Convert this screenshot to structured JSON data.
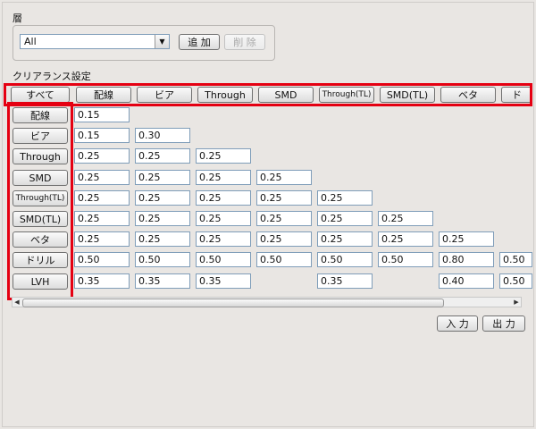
{
  "layer": {
    "label": "層",
    "selected_value": "All",
    "add_button": "追 加",
    "delete_button": "削 除"
  },
  "clearance": {
    "label": "クリアランス設定",
    "all_button": "すべて",
    "columns": [
      "配線",
      "ビア",
      "Through",
      "SMD",
      "Through(TL)",
      "SMD(TL)",
      "ベタ",
      "ド"
    ],
    "rows": [
      {
        "name": "配線",
        "values": [
          "0.15"
        ]
      },
      {
        "name": "ビア",
        "values": [
          "0.15",
          "0.30"
        ]
      },
      {
        "name": "Through",
        "values": [
          "0.25",
          "0.25",
          "0.25"
        ]
      },
      {
        "name": "SMD",
        "values": [
          "0.25",
          "0.25",
          "0.25",
          "0.25"
        ]
      },
      {
        "name": "Through(TL)",
        "values": [
          "0.25",
          "0.25",
          "0.25",
          "0.25",
          "0.25"
        ]
      },
      {
        "name": "SMD(TL)",
        "values": [
          "0.25",
          "0.25",
          "0.25",
          "0.25",
          "0.25",
          "0.25"
        ]
      },
      {
        "name": "ベタ",
        "values": [
          "0.25",
          "0.25",
          "0.25",
          "0.25",
          "0.25",
          "0.25",
          "0.25"
        ]
      },
      {
        "name": "ドリル",
        "values": [
          "0.50",
          "0.50",
          "0.50",
          "0.50",
          "0.50",
          "0.50",
          "0.80",
          "0.50"
        ]
      },
      {
        "name": "LVH",
        "values": [
          "0.35",
          "0.35",
          "0.35",
          null,
          "0.35",
          null,
          "0.40",
          "0.50"
        ]
      }
    ]
  },
  "footer": {
    "input_button": "入 力",
    "output_button": "出 力"
  }
}
